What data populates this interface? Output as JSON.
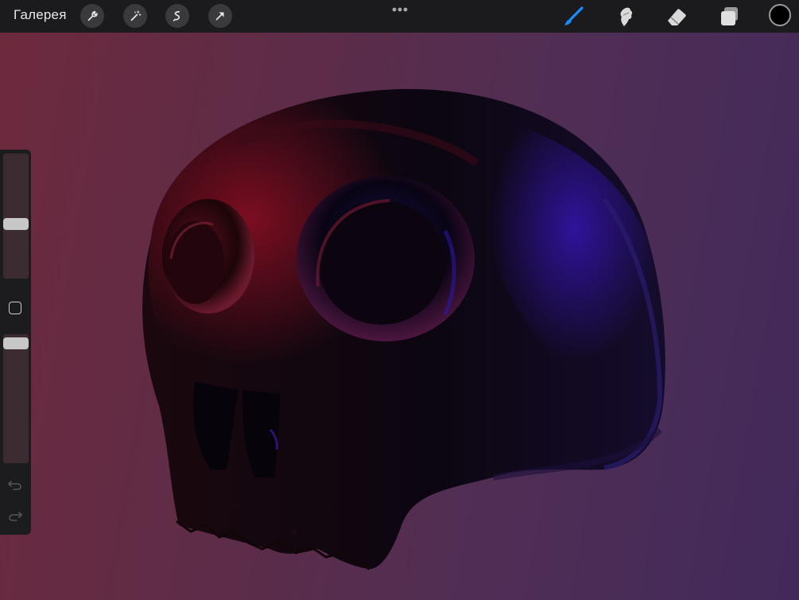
{
  "toolbar": {
    "gallery_label": "Галерея",
    "left_tools": [
      "wrench-icon",
      "magic-wand-icon",
      "selection-icon",
      "move-arrow-icon"
    ],
    "right_tools": [
      "brush-icon",
      "smudge-icon",
      "eraser-icon",
      "layers-icon"
    ],
    "active_tool": "brush-icon",
    "accent_color": "#1a8cff",
    "current_color": "#000000"
  },
  "sidebar": {
    "brush_size_level": 0.43,
    "opacity_level": 0.97
  },
  "canvas": {
    "background_colors": [
      "#6d2a3d",
      "#42295a"
    ]
  }
}
